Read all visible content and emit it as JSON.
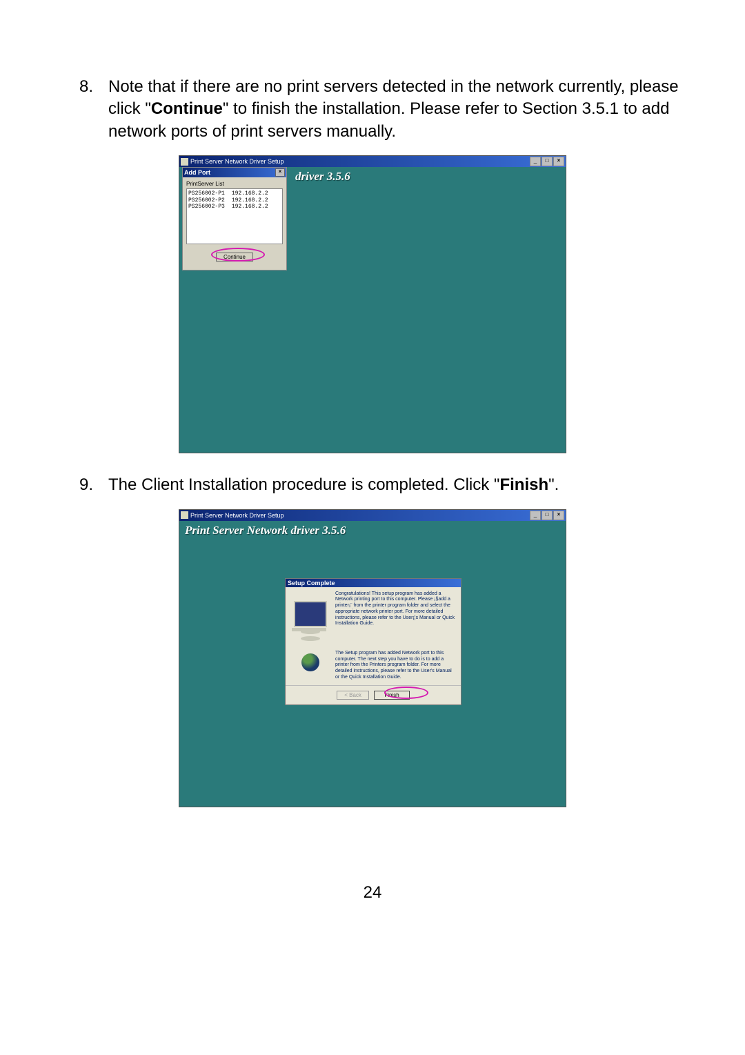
{
  "step8": {
    "num": "8.",
    "text_before": "Note that if there are no print servers detected in the network currently, please click \"",
    "bold": "Continue",
    "text_after": "\" to finish the installation. Please refer to Section 3.5.1 to add network ports of print servers manually."
  },
  "screenshot1": {
    "window_title": "Print Server Network Driver Setup",
    "banner": "driver 3.5.6",
    "addport": {
      "title": "Add Port",
      "list_label": "PrintServer List",
      "servers": [
        {
          "name": "PS256002-P1",
          "ip": "192.168.2.2"
        },
        {
          "name": "PS256002-P2",
          "ip": "192.168.2.2"
        },
        {
          "name": "PS256002-P3",
          "ip": "192.168.2.2"
        }
      ],
      "continue_label": "Continue"
    }
  },
  "step9": {
    "num": "9.",
    "text_before": "The Client Installation procedure is completed. Click \"",
    "bold": "Finish",
    "text_after": "\"."
  },
  "screenshot2": {
    "window_title": "Print Server Network Driver Setup",
    "banner": "Print Server Network driver 3.5.6",
    "setup": {
      "title": "Setup Complete",
      "para1": "Congratulations! This setup program has added a Network printing port to this computer. Please ¡§add a printer¡¨ from the printer program folder and select the appropriate network printer port. For more detailed instructions, please refer to the User¡¦s Manual or Quick Installation Guide.",
      "para2": "The Setup program has added Network port to this computer. The next step you have to do is to add a printer from the Printers program folder. For more detailed instructions, please refer to the User's Manual or the Quick Installation Guide.",
      "back_label": "< Back",
      "finish_label": "Finish"
    }
  },
  "page_number": "24",
  "win_controls": {
    "min": "_",
    "max": "□",
    "close": "×"
  }
}
